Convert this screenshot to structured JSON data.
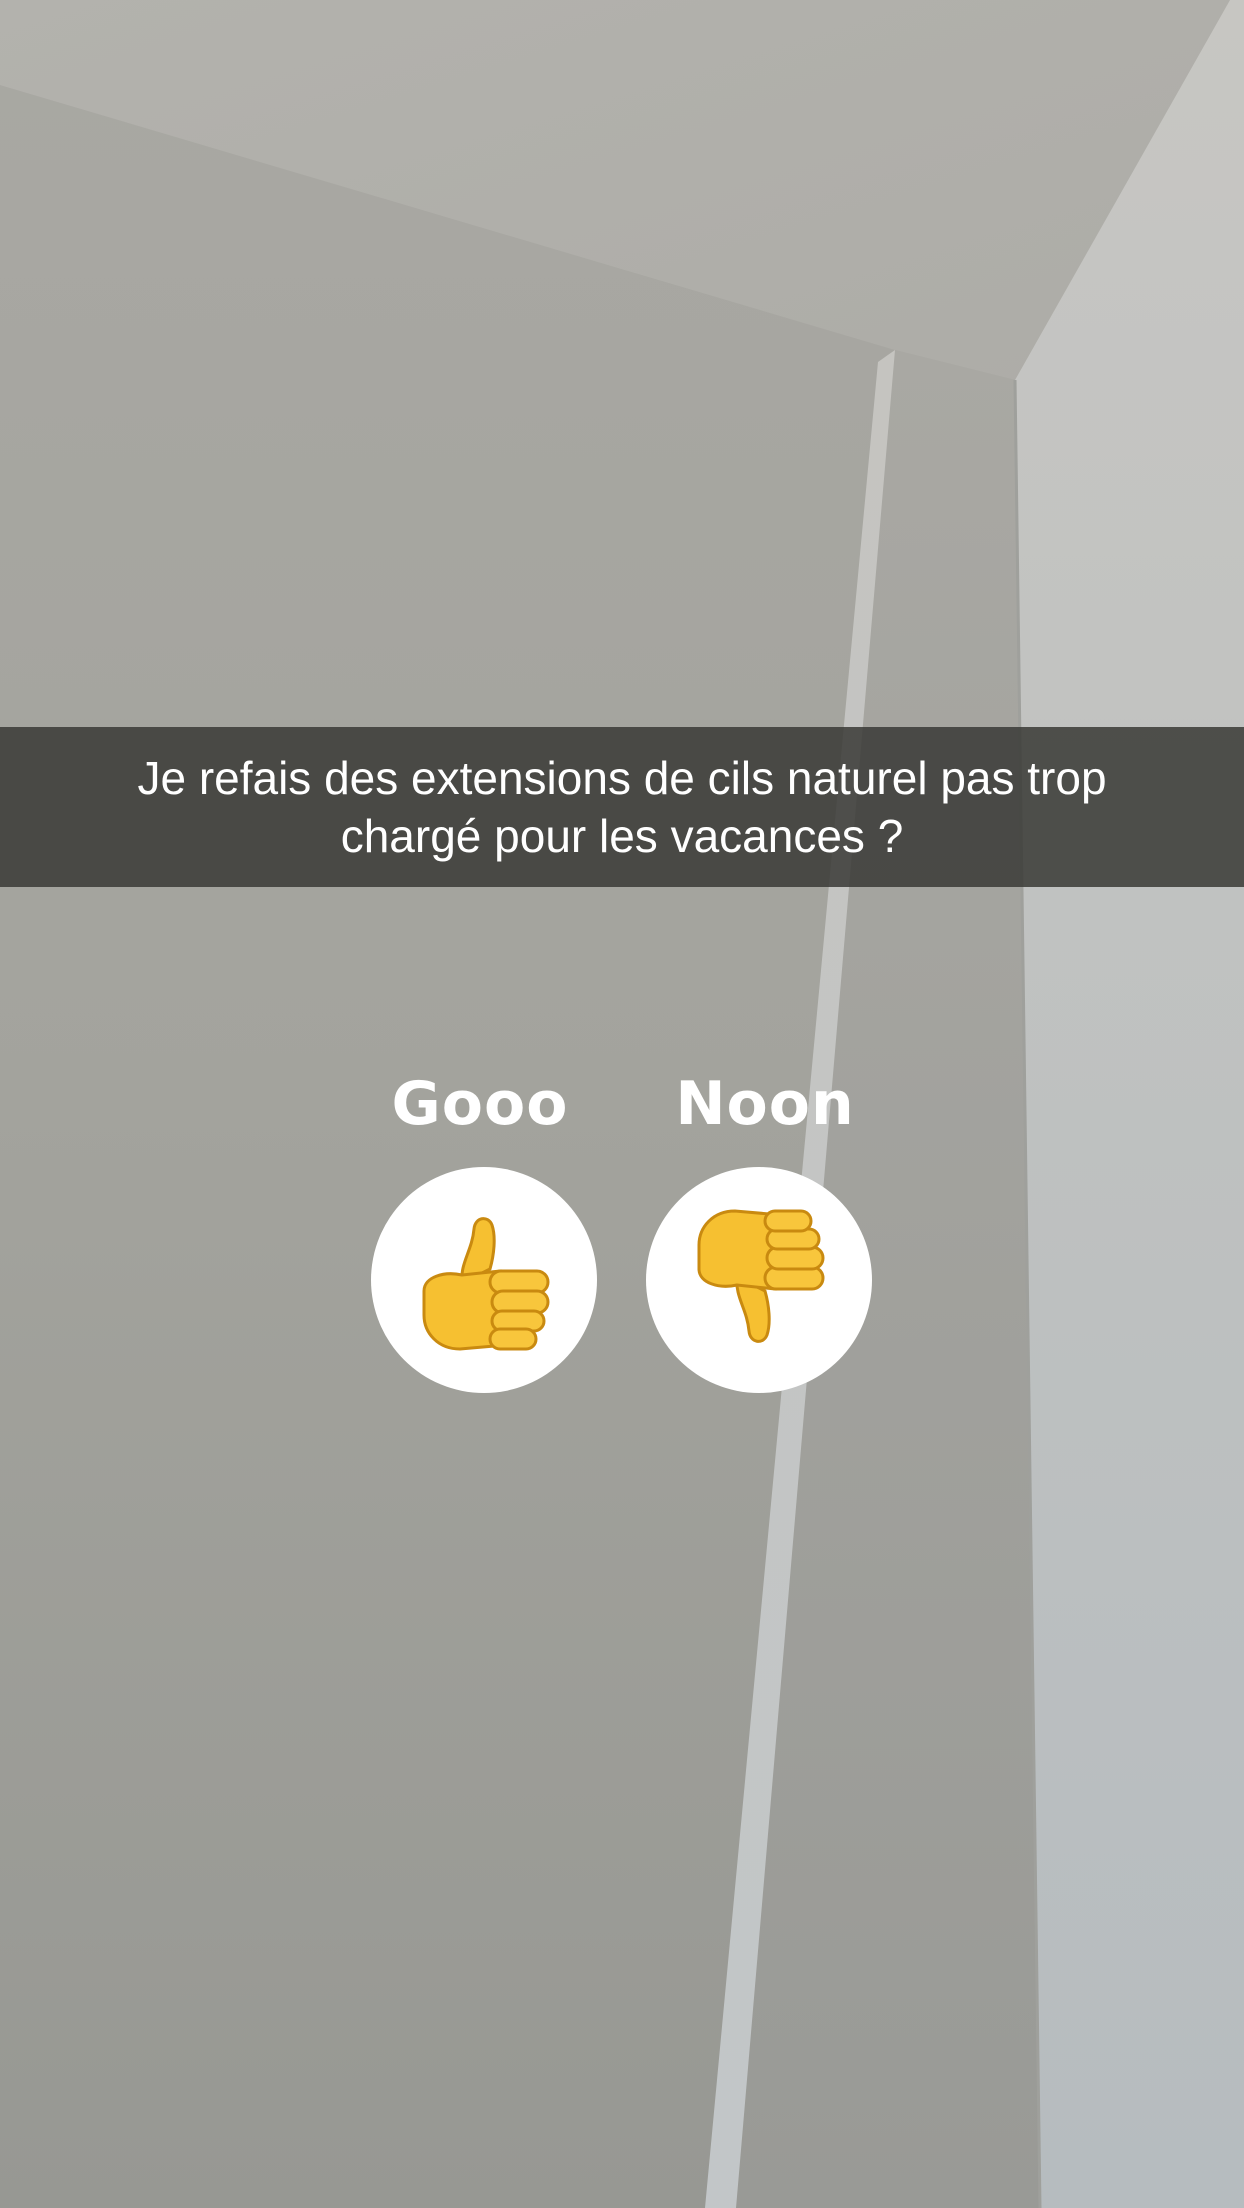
{
  "caption": {
    "text": "Je refais des extensions de cils naturel pas trop\nchargé pour les vacances ?",
    "background_color": "#3a3a37"
  },
  "poll": {
    "options": [
      {
        "label": "Gooo",
        "icon": "thumbs-up-icon"
      },
      {
        "label": "Noon",
        "icon": "thumbs-down-icon"
      }
    ],
    "emoji_color": "#f6c031"
  }
}
